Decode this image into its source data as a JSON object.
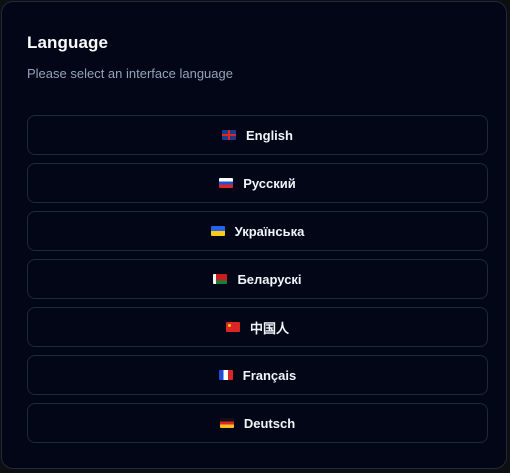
{
  "dialog": {
    "title": "Language",
    "subtitle": "Please select an interface language"
  },
  "languages": [
    {
      "label": "English",
      "flag": "gb-flag-icon"
    },
    {
      "label": "Русский",
      "flag": "ru-flag-icon"
    },
    {
      "label": "Українська",
      "flag": "ua-flag-icon"
    },
    {
      "label": "Беларускі",
      "flag": "by-flag-icon"
    },
    {
      "label": "中国人",
      "flag": "cn-flag-icon"
    },
    {
      "label": "Français",
      "flag": "fr-flag-icon"
    },
    {
      "label": "Deutsch",
      "flag": "de-flag-icon"
    }
  ],
  "colors": {
    "background": "#020617",
    "border": "#1f2937",
    "title": "#f8fafc",
    "subtitle": "#94a3b8"
  }
}
